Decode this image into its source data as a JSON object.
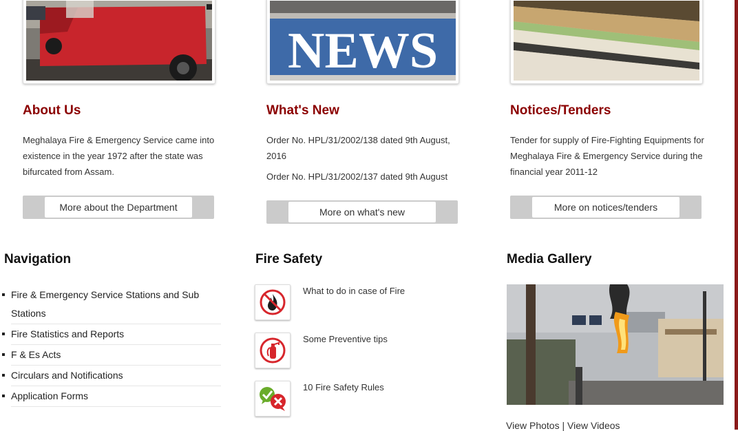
{
  "cards": [
    {
      "title": "About Us",
      "paragraphs": [
        "Meghalaya Fire & Emergency Service came into existence in the year 1972 after the state was bifurcated from Assam."
      ],
      "button": "More about the Department"
    },
    {
      "title": "What's New",
      "paragraphs": [
        "Order No. HPL/31/2002/138 dated 9th August, 2016",
        "Order No. HPL/31/2002/137 dated 9th August"
      ],
      "button": "More on what's new"
    },
    {
      "title": "Notices/Tenders",
      "paragraphs": [
        "Tender for supply of Fire-Fighting Equipments for Meghalaya Fire & Emergency Service during the financial year 2011-12"
      ],
      "button": "More on notices/tenders"
    }
  ],
  "news_image_text": "NEWS",
  "navigation": {
    "title": "Navigation",
    "items": [
      "Fire & Emergency Service Stations and Sub Stations",
      "Fire Statistics and Reports",
      "F & Es Acts",
      "Circulars and Notifications",
      "Application Forms"
    ]
  },
  "fire_safety": {
    "title": "Fire Safety",
    "items": [
      {
        "label": "What to do in case of Fire",
        "icon": "no-fire-icon"
      },
      {
        "label": "Some Preventive tips",
        "icon": "fire-extinguisher-icon"
      },
      {
        "label": "10 Fire Safety Rules",
        "icon": "check-cross-icon"
      }
    ]
  },
  "media_gallery": {
    "title": "Media Gallery",
    "photos_link": "View Photos",
    "separator": "|",
    "videos_link": "View Videos"
  },
  "colors": {
    "accent": "#8b0000",
    "button_bg": "#cbcbcb",
    "border_right": "#8b1a1a"
  }
}
